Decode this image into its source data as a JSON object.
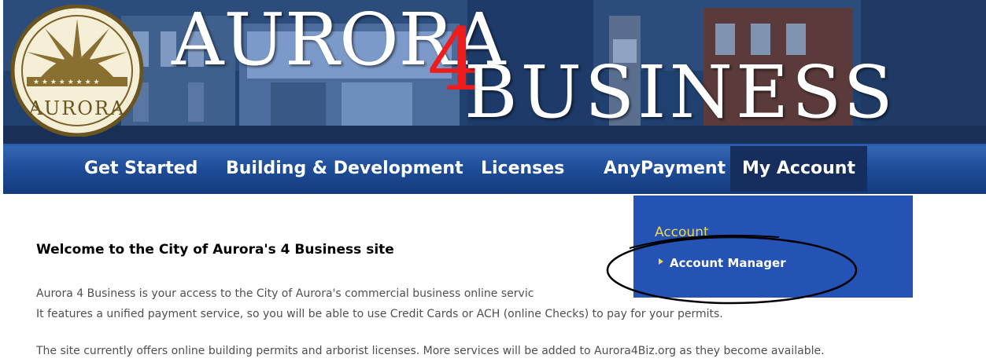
{
  "banner": {
    "title_part1": "AURORA",
    "title_num": "4",
    "title_part2": "BUSINESS",
    "logo_text": "AURORA"
  },
  "nav": {
    "items": [
      {
        "label": "Get Started"
      },
      {
        "label": "Building & Development"
      },
      {
        "label": "Licenses"
      },
      {
        "label": "AnyPayment"
      },
      {
        "label": "My Account"
      }
    ]
  },
  "dropdown": {
    "title": "Account",
    "item": "Account Manager"
  },
  "content": {
    "title": "Welcome to the City of Aurora's 4 Business site",
    "p1": "Aurora 4 Business is your access to the City of Aurora's commercial business online servic",
    "p2": "It features a unified payment service, so you will be able to use Credit Cards or ACH (online Checks) to pay for your permits.",
    "p3": "The site currently offers online building permits and arborist licenses. More services will be added to Aurora4Biz.org as they become available."
  },
  "colors": {
    "nav_blue": "#1f4d9a",
    "dropdown_blue": "#2453b5",
    "accent_yellow": "#f1d84b",
    "logo_red": "#ee1c1c"
  }
}
